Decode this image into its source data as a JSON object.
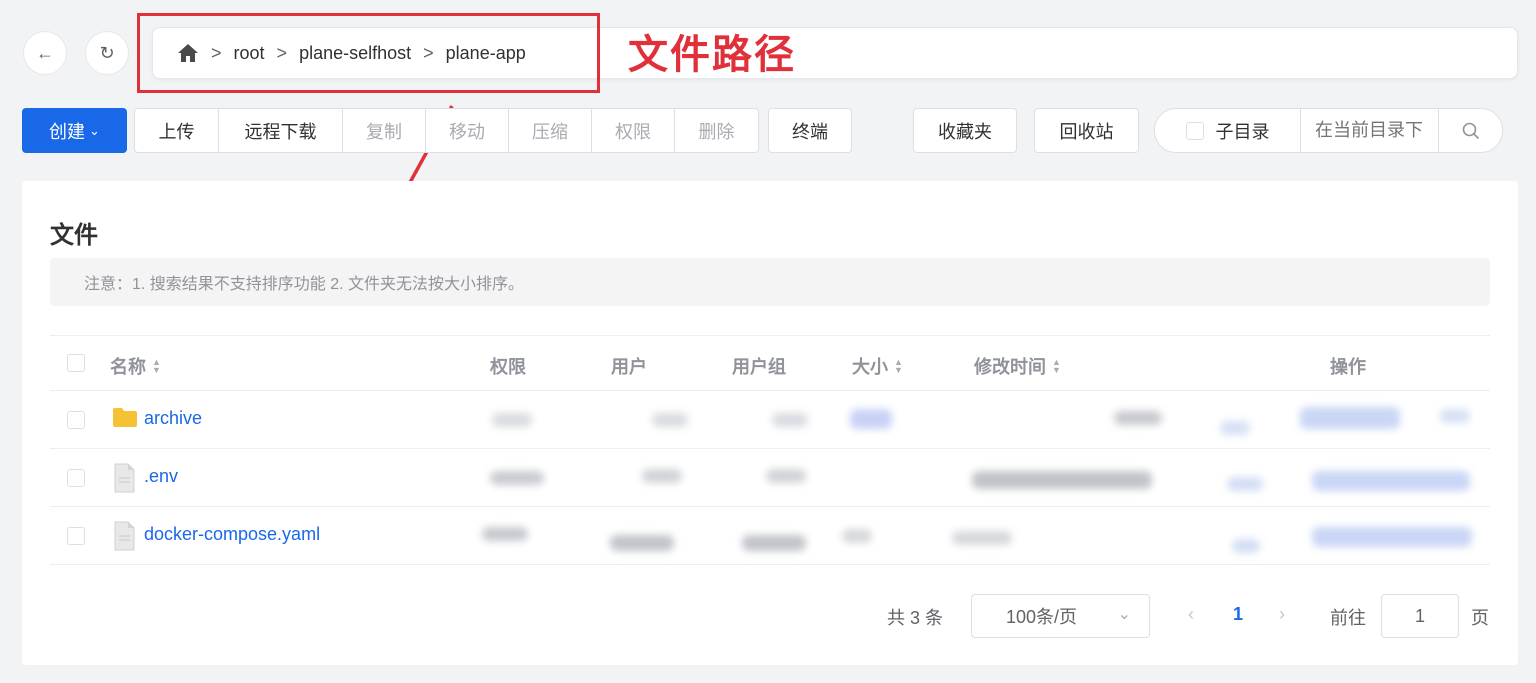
{
  "nav": {
    "back_icon": "arrow-left-icon",
    "refresh_icon": "refresh-icon"
  },
  "breadcrumb": {
    "home_icon": "home-icon",
    "separator": ">",
    "items": [
      "root",
      "plane-selfhost",
      "plane-app"
    ]
  },
  "annotation": {
    "label": "文件路径",
    "color": "#e0303a"
  },
  "toolbar": {
    "create_label": "创建",
    "group_buttons": [
      {
        "label": "上传",
        "disabled": false
      },
      {
        "label": "远程下载",
        "disabled": false
      },
      {
        "label": "复制",
        "disabled": true
      },
      {
        "label": "移动",
        "disabled": true
      },
      {
        "label": "压缩",
        "disabled": true
      },
      {
        "label": "权限",
        "disabled": true
      },
      {
        "label": "删除",
        "disabled": true
      }
    ],
    "terminal_label": "终端",
    "favorites_label": "收藏夹",
    "recycle_label": "回收站",
    "subdir_label": "子目录",
    "search_placeholder": "在当前目录下",
    "accent": "#1868e8"
  },
  "card": {
    "title": "文件",
    "notice": "注意：1. 搜索结果不支持排序功能 2. 文件夹无法按大小排序。"
  },
  "table": {
    "headers": {
      "name": "名称",
      "permission": "权限",
      "user": "用户",
      "group": "用户组",
      "size": "大小",
      "modified": "修改时间",
      "actions": "操作"
    },
    "rows": [
      {
        "name": "archive",
        "type": "folder"
      },
      {
        "name": ".env",
        "type": "file"
      },
      {
        "name": "docker-compose.yaml",
        "type": "file"
      }
    ]
  },
  "pagination": {
    "total": "共 3 条",
    "page_size": "100条/页",
    "current_page": "1",
    "goto_label": "前往",
    "goto_value": "1",
    "page_suffix": "页"
  }
}
